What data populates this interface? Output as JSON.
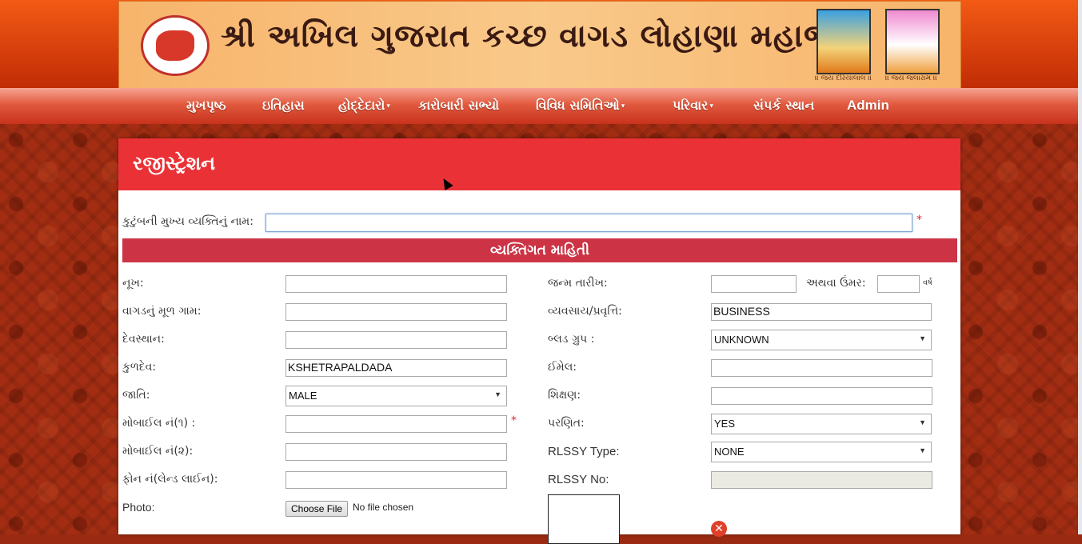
{
  "banner": {
    "title": "શ્રી અખિલ ગુજરાત કચ્છ વાગડ લોહાણા મહાજન",
    "deity1_caption": "।। જય દરિયાલાલ ।।",
    "deity2_caption": "।। જય જલારામ ।।"
  },
  "nav": {
    "items": [
      {
        "label": "મુખપૃષ્ઠ"
      },
      {
        "label": "ઇતિહાસ"
      },
      {
        "label": "હોદ્દેદારો"
      },
      {
        "label": "કારોબારી સભ્યો"
      },
      {
        "label": "વિવિધ સમિતિઓ"
      },
      {
        "label": "પરિવાર"
      },
      {
        "label": "સંપર્ક સ્થાન"
      },
      {
        "label": "Admin"
      }
    ]
  },
  "form": {
    "title": "રજીસ્ટ્રેશન",
    "head_label": "કુટુંબની મુખ્ય વ્યક્તિનું નામ:",
    "head_value": "",
    "section_title": "વ્યક્તિગત માહિતી",
    "left": {
      "nukh_label": "નૂખ:",
      "village_label": "વાગડનું મૂળ ગામ:",
      "devsthan_label": "દેવસ્થાન:",
      "kuldev_label": "કુળદેવ:",
      "kuldev_value": "KSHETRAPALDADA",
      "gender_label": "જાતિ:",
      "gender_value": "MALE",
      "mobile1_label": "મોબાઈલ નં(૧) :",
      "mobile2_label": "મોબાઈલ નં(૨):",
      "phone_label": "ફોન નં(લેન્ડ લાઈન):",
      "photo_label": "Photo:",
      "file_button": "Choose File",
      "file_status": "No file chosen"
    },
    "right": {
      "dob_label": "જન્મ તારીખ:",
      "age_label": "અથવા ઉંમર:",
      "age_unit": "વર્ષ",
      "occupation_label": "વ્યવસાય/પ્રવૃત્તિ:",
      "occupation_value": "BUSINESS",
      "blood_label": "બ્લડ ગ્રુપ :",
      "blood_value": "UNKNOWN",
      "email_label": "ઈમેલ:",
      "education_label": "શિક્ષણ:",
      "married_label": "પરણિત:",
      "married_value": "YES",
      "rlssy_type_label": "RLSSY Type:",
      "rlssy_type_value": "NONE",
      "rlssy_no_label": "RLSSY No:"
    },
    "required_mark": "*"
  }
}
